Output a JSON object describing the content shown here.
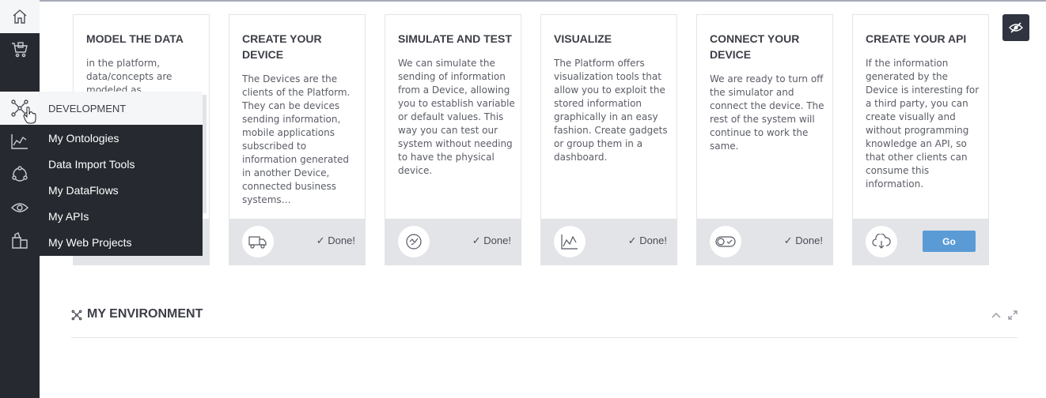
{
  "sidebar": {
    "items": [
      {
        "icon": "home-icon"
      },
      {
        "icon": "cart-icon"
      },
      {
        "icon": "network-icon"
      },
      {
        "icon": "chart-icon"
      },
      {
        "icon": "cycle-icon"
      },
      {
        "icon": "eye-icon"
      },
      {
        "icon": "boxes-icon"
      }
    ]
  },
  "flyout": {
    "header": "DEVELOPMENT",
    "items": [
      "My Ontologies",
      "Data Import Tools",
      "My DataFlows",
      "My APIs",
      "My Web Projects"
    ]
  },
  "cards": [
    {
      "title": "MODEL THE DATA",
      "body": "in the platform, data/concepts are modeled as",
      "status": "",
      "icon": "ontology-icon"
    },
    {
      "title": "CREATE YOUR DEVICE",
      "body": "The Devices are the clients of the Platform. They can be devices sending information, mobile applications subscribed to information generated in another Device, connected business systems…",
      "status": "Done!",
      "icon": "truck-icon"
    },
    {
      "title": "SIMULATE AND TEST",
      "body": "We can simulate the sending of information from a Device, allowing you to establish variable or default values. This way you can test our system without needing to have the physical device.",
      "status": "Done!",
      "icon": "simulate-icon"
    },
    {
      "title": "VISUALIZE",
      "body": "The Platform offers visualization tools that allow you to exploit the stored information graphically in an easy fashion. Create gadgets or group them in a dashboard.",
      "status": "Done!",
      "icon": "chart-icon"
    },
    {
      "title": "CONNECT YOUR DEVICE",
      "body": "We are ready to turn off the simulator and connect the device. The rest of the system will continue to work the same.",
      "status": "Done!",
      "icon": "toggle-icon"
    },
    {
      "title": "CREATE YOUR API",
      "body": "If the information generated by the Device is interesting for a third party, you can create visually and without programming knowledge an API, so that other clients can consume this information.",
      "status": "",
      "button": "Go",
      "icon": "cloud-download-icon"
    }
  ],
  "environment": {
    "title": "MY ENVIRONMENT"
  },
  "colors": {
    "sidebar": "#262a30",
    "go_button": "#5b9bd5",
    "card_footer": "#e3e4e8"
  }
}
